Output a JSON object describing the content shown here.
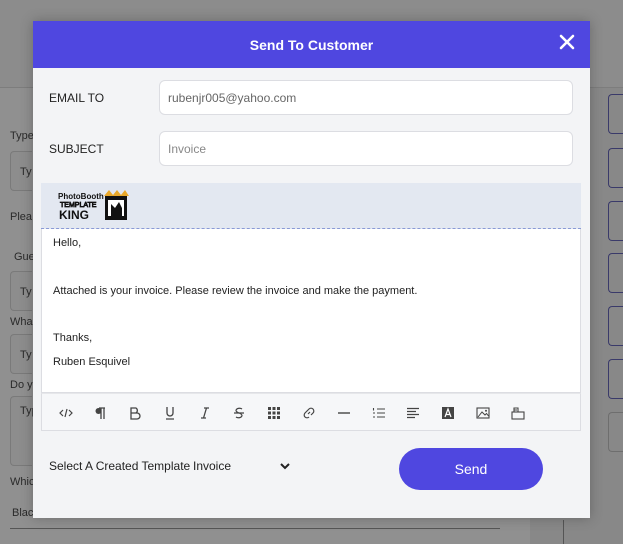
{
  "background": {
    "labels": [
      "Type",
      "Plea",
      "Gue",
      "Wha",
      "Do y",
      "Whic",
      "Blac"
    ],
    "box_text": [
      "Ty",
      "Ty",
      "Ty",
      "Typ"
    ]
  },
  "modal": {
    "title": "Send To Customer",
    "email_label": "EMAIL TO",
    "email_value": "rubenjr005@yahoo.com",
    "subject_label": "SUBJECT",
    "subject_placeholder": "Invoice",
    "logo_text_top": "PhotoBooth",
    "logo_text_mid": "TEMPLATE",
    "logo_text_bottom": "KING",
    "body": {
      "greeting": "Hello,",
      "message": "Attached is your invoice. Please review the invoice and make the payment.",
      "closing": "Thanks,",
      "signature": "Ruben Esquivel"
    },
    "toolbar_icons": [
      "code-view-icon",
      "paragraph-icon",
      "bold-icon",
      "underline-icon",
      "italic-icon",
      "strikethrough-icon",
      "table-icon",
      "link-icon",
      "horizontal-rule-icon",
      "ordered-list-icon",
      "align-icon",
      "text-color-icon",
      "image-icon",
      "video-icon"
    ],
    "template_label": "Select A Created Template",
    "template_selected": "Invoice",
    "send_label": "Send"
  },
  "colors": {
    "accent": "#4f47e0",
    "modal_bg": "#f3f4f6",
    "overlay": "#8f8f8f"
  }
}
